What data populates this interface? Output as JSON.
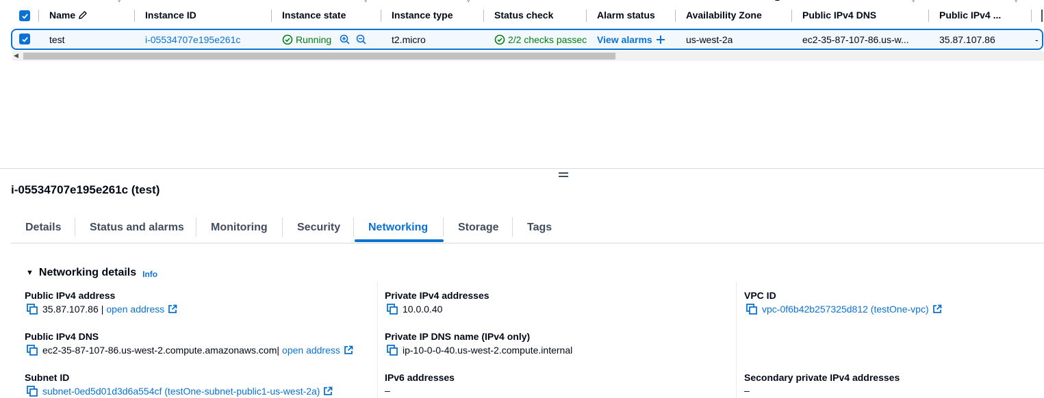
{
  "table": {
    "columns": [
      {
        "label": "Name",
        "sort": "▽"
      },
      {
        "label": "Instance ID"
      },
      {
        "label": "Instance state",
        "sort": "▽"
      },
      {
        "label": "Instance type",
        "sort": "▽"
      },
      {
        "label": "Status check"
      },
      {
        "label": "Alarm status"
      },
      {
        "label": "Availability Zone",
        "sort": "▲"
      },
      {
        "label": "Public IPv4 DNS",
        "sort": "▽"
      },
      {
        "label": "Public IPv4 ...",
        "sort": "▽"
      }
    ],
    "row": {
      "name": "test",
      "instance_id": "i-05534707e195e261c",
      "state": "Running",
      "type": "t2.micro",
      "status_check": "2/2 checks passec",
      "alarm": "View alarms",
      "az": "us-west-2a",
      "dns": "ec2-35-87-107-86.us-w...",
      "ipv4": "35.87.107.86",
      "overflow": "-"
    }
  },
  "panel": {
    "title": "i-05534707e195e261c (test)",
    "tabs": [
      "Details",
      "Status and alarms",
      "Monitoring",
      "Security",
      "Networking",
      "Storage",
      "Tags"
    ],
    "active_tab": "Networking"
  },
  "networking": {
    "title": "Networking details",
    "info": "Info",
    "public_ipv4": {
      "label": "Public IPv4 address",
      "value": "35.87.107.86",
      "sep": "|",
      "link": "open address"
    },
    "private_ipv4": {
      "label": "Private IPv4 addresses",
      "value": "10.0.0.40"
    },
    "vpc": {
      "label": "VPC ID",
      "value": "vpc-0f6b42b257325d812 (testOne-vpc)"
    },
    "public_dns": {
      "label": "Public IPv4 DNS",
      "value": "ec2-35-87-107-86.us-west-2.compute.amazonaws.com",
      "sep": "|",
      "link": "open address"
    },
    "private_dns": {
      "label": "Private IP DNS name (IPv4 only)",
      "value": "ip-10-0-0-40.us-west-2.compute.internal"
    },
    "subnet": {
      "label": "Subnet ID",
      "value": "subnet-0ed5d01d3d6a554cf (testOne-subnet-public1-us-west-2a)"
    },
    "ipv6": {
      "label": "IPv6 addresses",
      "value": "–"
    },
    "secondary": {
      "label": "Secondary private IPv4 addresses",
      "value": "–"
    }
  },
  "colors": {
    "link": "#0972d3",
    "success": "#037f0c",
    "text": "#000716"
  }
}
